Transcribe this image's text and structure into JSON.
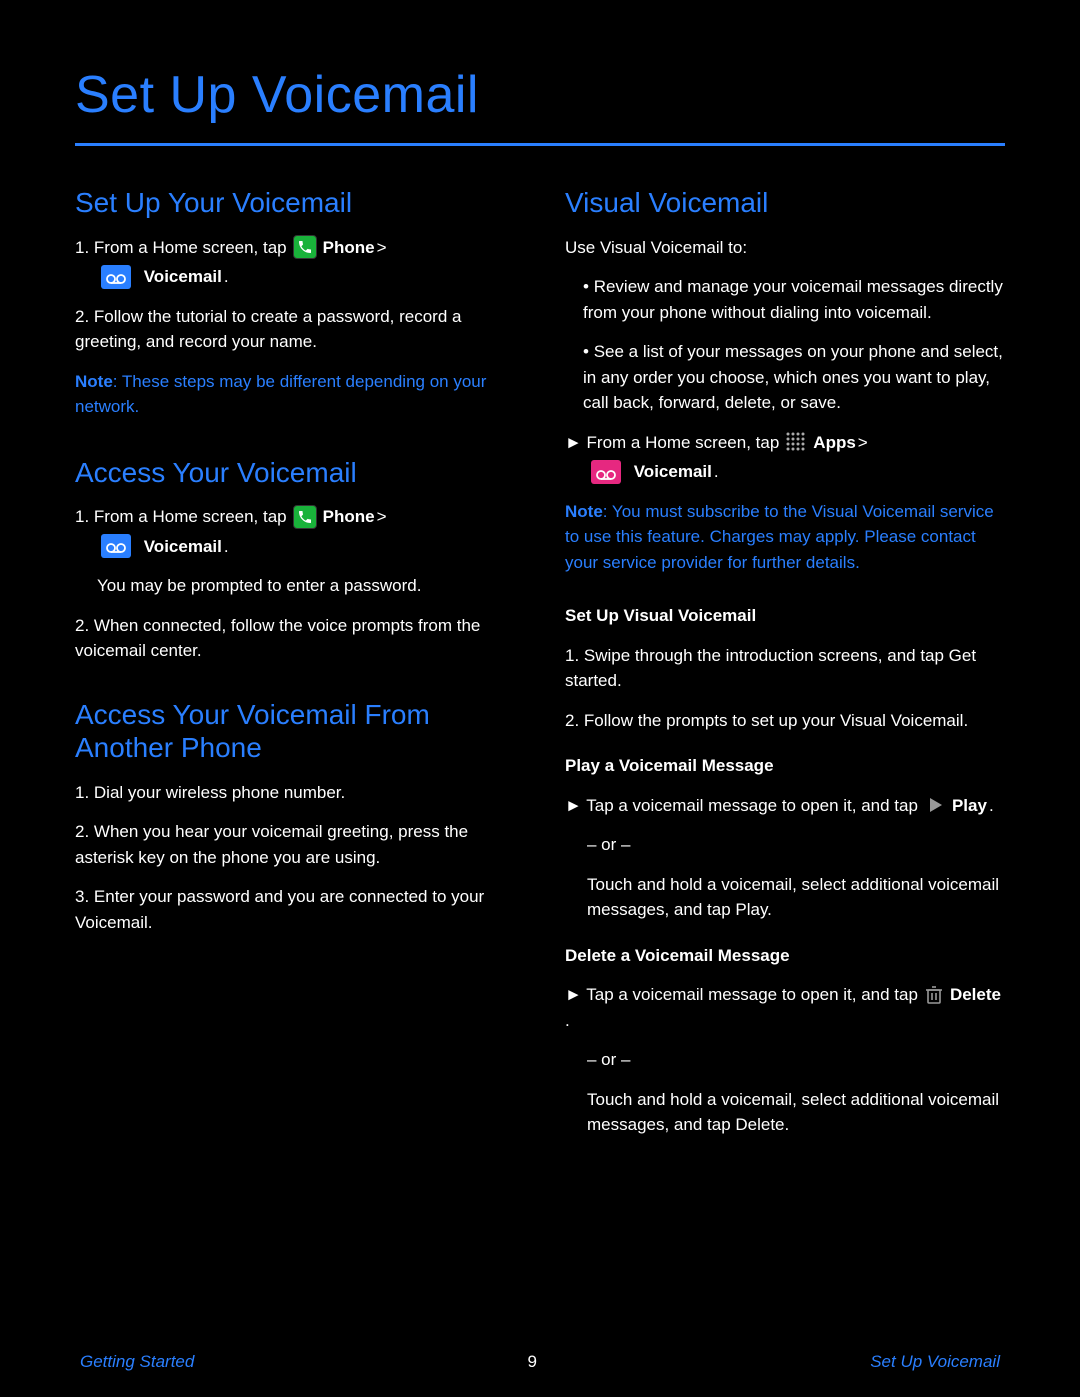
{
  "title": "Set Up Voicemail",
  "footer": {
    "left": "Getting Started",
    "page": "9",
    "right": "Set Up Voicemail"
  },
  "labels": {
    "phone": "Phone",
    "voicemail": "Voicemail",
    "apps": "Apps",
    "play": "Play",
    "delete": "Delete",
    "note": "Note"
  },
  "left": {
    "setup": {
      "title": "Set Up Your Voicemail",
      "step1_pre": "1.  From a Home screen, tap ",
      "step1_post": " >",
      "step1_line2_post": ".",
      "step2": "2.  Follow the tutorial to create a password, record a greeting, and record your name.",
      "note_body": ": These steps may be different depending on your network."
    },
    "access": {
      "title": "Access Your Voicemail",
      "step1_pre": "1.  From a Home screen, tap ",
      "step1_post": " >",
      "step1_line2_post": ".",
      "step_or": "You may be prompted to enter a password.",
      "step2": "2.  When connected, follow the voice prompts from the voicemail center."
    },
    "another": {
      "title": "Access Your Voicemail From Another Phone",
      "step1": "1.  Dial your wireless phone number.",
      "step2": "2.  When you hear your voicemail greeting, press the asterisk key on the phone you are using.",
      "step3": "3.  Enter your password and you are connected to your Voicemail."
    }
  },
  "right": {
    "title": "Visual Voicemail",
    "intro": "Use Visual Voicemail to:",
    "bullets": [
      "Review and manage your voicemail messages directly from your phone without dialing into voicemail.",
      "See a list of your messages on your phone and select, in any order you choose, which ones you want to play, call back, forward, delete, or save."
    ],
    "launch_pre": "► From a Home screen, tap ",
    "launch_mid": " > ",
    "launch_post": ".",
    "note_body": ": You must subscribe to the Visual Voicemail service to use this feature. Charges may apply. Please contact your service provider for further details.",
    "setup_title": "Set Up Visual Voicemail",
    "setup_step1": "1.  Swipe through the introduction screens, and tap Get started.",
    "setup_step2": "2.  Follow the prompts to set up your Visual Voicemail.",
    "play_title": "Play a Voicemail Message",
    "play_step_pre": "► Tap a voicemail message to open it, and tap ",
    "play_step_post": ".",
    "play_or": "– or –",
    "play_alt": "Touch and hold a voicemail, select additional voicemail messages, and tap Play.",
    "delete_title": "Delete a Voicemail Message",
    "delete_step_pre": "► Tap a voicemail message to open it, and tap ",
    "delete_step_post": ".",
    "delete_or": "– or –",
    "delete_alt": "Touch and hold a voicemail, select additional voicemail messages, and tap Delete."
  }
}
